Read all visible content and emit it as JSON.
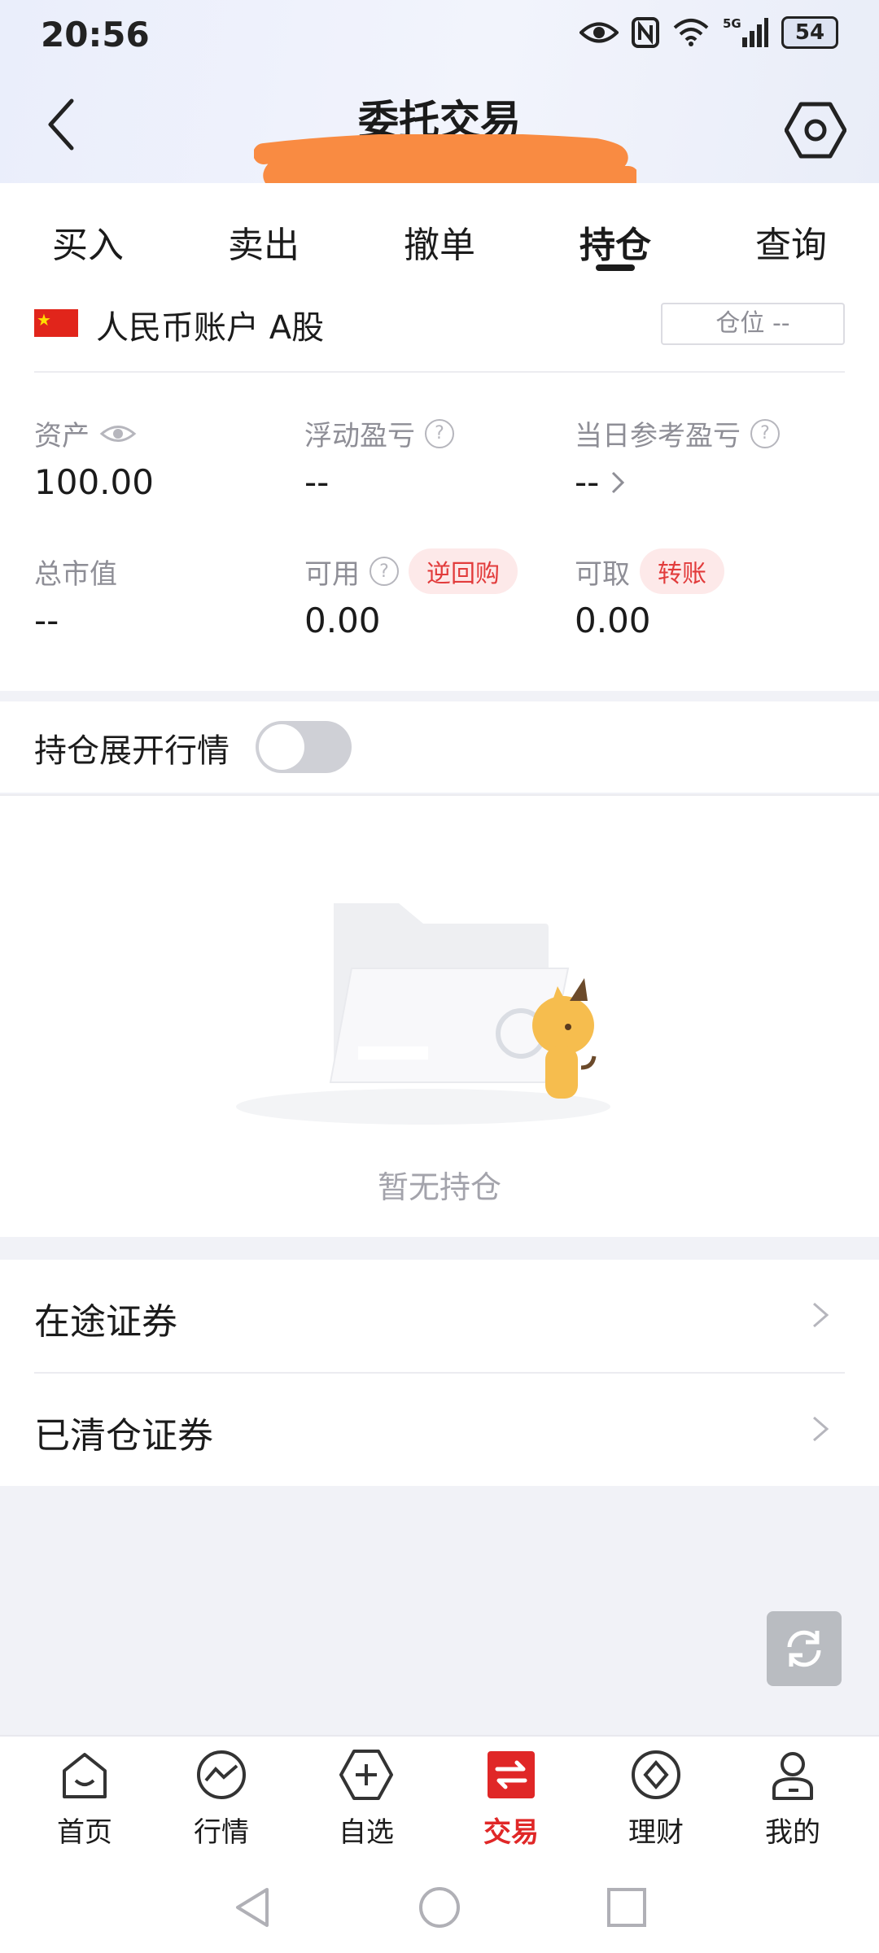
{
  "status_bar": {
    "time": "20:56",
    "battery": "54"
  },
  "header": {
    "title": "委托交易"
  },
  "tabs": [
    {
      "label": "买入",
      "active": false
    },
    {
      "label": "卖出",
      "active": false
    },
    {
      "label": "撤单",
      "active": false
    },
    {
      "label": "持仓",
      "active": true
    },
    {
      "label": "查询",
      "active": false
    }
  ],
  "account": {
    "name": "人民币账户 A股",
    "position_button": "仓位 --"
  },
  "metrics": {
    "assets": {
      "label": "资产",
      "value": "100.00"
    },
    "floating_pnl": {
      "label": "浮动盈亏",
      "value": "--"
    },
    "daily_pnl": {
      "label": "当日参考盈亏",
      "value": "--"
    },
    "market_value": {
      "label": "总市值",
      "value": "--"
    },
    "available": {
      "label": "可用",
      "value": "0.00",
      "action": "逆回购"
    },
    "withdrawable": {
      "label": "可取",
      "value": "0.00",
      "action": "转账"
    }
  },
  "toggle": {
    "label": "持仓展开行情",
    "on": false
  },
  "empty_state": {
    "text": "暂无持仓"
  },
  "lists": [
    {
      "label": "在途证券"
    },
    {
      "label": "已清仓证券"
    }
  ],
  "bottom_nav": [
    {
      "label": "首页",
      "icon": "home-icon",
      "active": false
    },
    {
      "label": "行情",
      "icon": "market-icon",
      "active": false
    },
    {
      "label": "自选",
      "icon": "watchlist-icon",
      "active": false
    },
    {
      "label": "交易",
      "icon": "trade-icon",
      "active": true
    },
    {
      "label": "理财",
      "icon": "wealth-icon",
      "active": false
    },
    {
      "label": "我的",
      "icon": "profile-icon",
      "active": false
    }
  ],
  "colors": {
    "accent": "#e02727",
    "pill_bg": "#fde9e9"
  }
}
